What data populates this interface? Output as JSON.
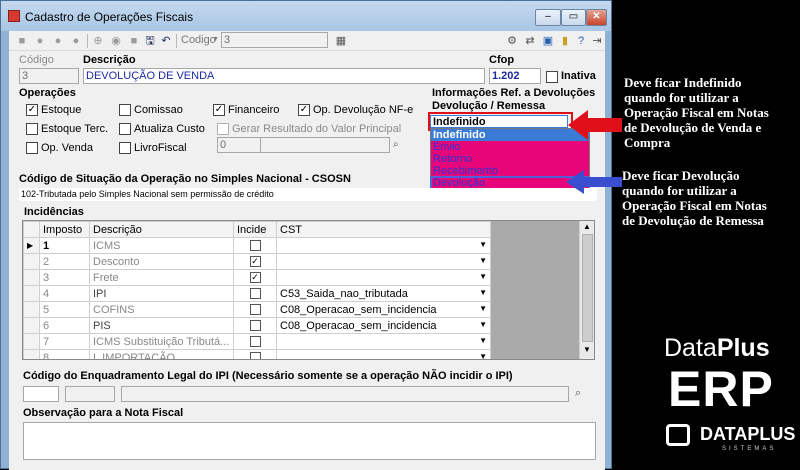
{
  "window": {
    "title": "Cadastro de Operações Fiscais"
  },
  "toolbar": {
    "search_field_label": "Codigo",
    "search_value": "3"
  },
  "form": {
    "codigo_label": "Código",
    "codigo_value": "3",
    "descricao_label": "Descrição",
    "descricao_value": "DEVOLUÇÃO DE VENDA",
    "cfop_label": "Cfop",
    "cfop_value": "1.202",
    "inativa_label": "Inativa"
  },
  "operacoes": {
    "title": "Operações",
    "estoque": "Estoque",
    "comissao": "Comissao",
    "financeiro": "Financeiro",
    "op_devolucao": "Op. Devolução NF-e",
    "estoque_terc": "Estoque Terc.",
    "atualiza_custo": "Atualiza Custo",
    "gerar_resultado": "Gerar Resultado do Valor Principal",
    "op_venda": "Op. Venda",
    "livro_fiscal": "LivroFiscal",
    "valor_field": "0"
  },
  "devolucoes": {
    "title": "Informações Ref. a Devoluções",
    "subtitle": "Devolução / Remessa",
    "selected": "Indefinido",
    "options": [
      "Indefinido",
      "Envio",
      "Retorno",
      "Recebimento",
      "Devolução"
    ]
  },
  "csosn": {
    "title": "Código de Situação da Operação no Simples Nacional - CSOSN",
    "value": "102-Tributada pelo Simples Nacional sem permissão de crédito"
  },
  "incidencias": {
    "title": "Incidências",
    "columns": [
      "Imposto",
      "Descrição",
      "Incide",
      "CST"
    ],
    "rows": [
      {
        "imposto": "1",
        "descricao": "ICMS",
        "incide": false,
        "cst": ""
      },
      {
        "imposto": "2",
        "descricao": "Desconto",
        "incide": true,
        "cst": ""
      },
      {
        "imposto": "3",
        "descricao": "Frete",
        "incide": true,
        "cst": ""
      },
      {
        "imposto": "4",
        "descricao": "IPI",
        "incide": false,
        "cst": "C53_Saida_nao_tributada"
      },
      {
        "imposto": "5",
        "descricao": "COFINS",
        "incide": false,
        "cst": "C08_Operacao_sem_incidencia"
      },
      {
        "imposto": "6",
        "descricao": "PIS",
        "incide": false,
        "cst": "C08_Operacao_sem_incidencia"
      },
      {
        "imposto": "7",
        "descricao": "ICMS Substituição Tributá...",
        "incide": false,
        "cst": ""
      },
      {
        "imposto": "8",
        "descricao": "I. IMPORTAÇÃO",
        "incide": false,
        "cst": ""
      }
    ]
  },
  "enquadramento": {
    "title": "Código do Enquadramento Legal do IPI (Necessário somente se a operação NÃO incidir o IPI)"
  },
  "observacao": {
    "title": "Observação para a Nota Fiscal"
  },
  "annotations": {
    "note1": [
      "Deve ficar Indefinido",
      "quando for utilizar a",
      "Operação Fiscal em Notas",
      "de Devolução de Venda e",
      "Compra"
    ],
    "note2": [
      "Deve ficar Devolução",
      "quando for utilizar a",
      "Operação Fiscal em Notas",
      "de Devolução de Remessa"
    ],
    "arrow_color": "#e0101a",
    "arrow2_color": "#3a4fd0"
  },
  "branding": {
    "line1_a": "Data",
    "line1_b": "Plus",
    "line2": "ERP",
    "line3": "DATAPLUS",
    "line4": "SISTEMAS"
  }
}
